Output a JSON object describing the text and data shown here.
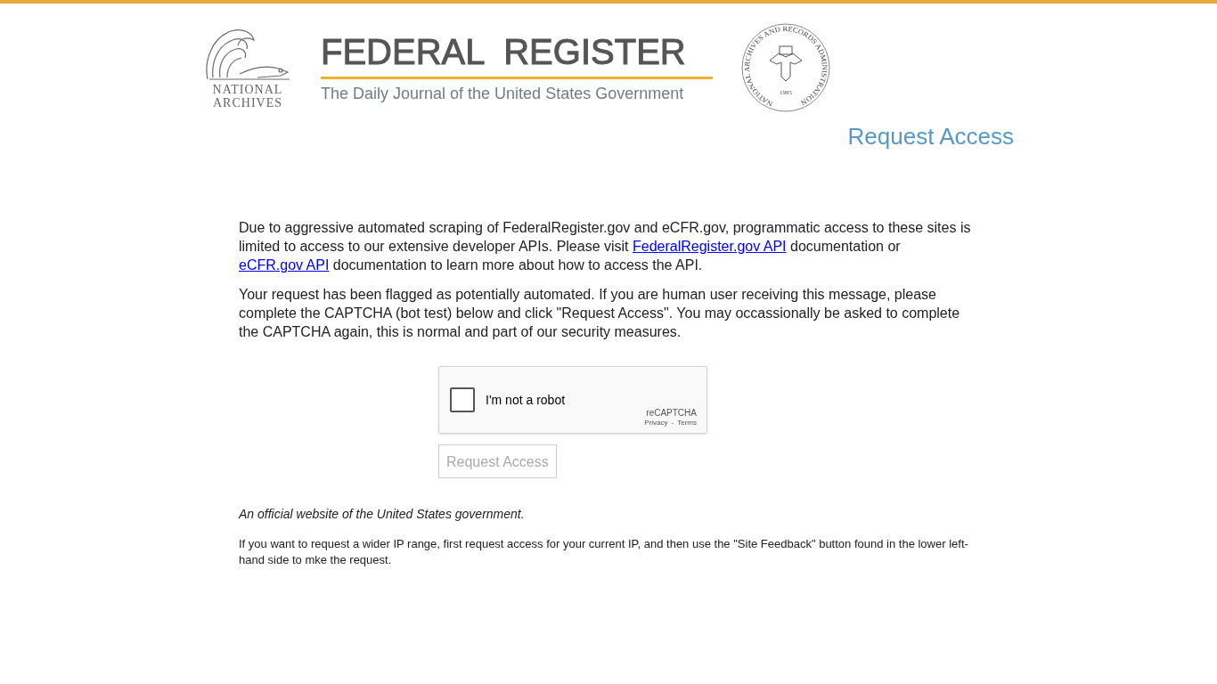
{
  "header": {
    "archives_logo": [
      "NATIONAL",
      "ARCHIVES"
    ],
    "title": "FEDERAL  REGISTER",
    "subtitle": "The Daily Journal of the United States Government",
    "seal": {
      "ring_text": "NATIONAL ARCHIVES AND RECORDS ADMINISTRATION",
      "year": "1985"
    }
  },
  "heading": "Request Access",
  "paragraphs": [
    [
      {
        "kind": "text",
        "text": "Due to aggressive automated scraping of FederalRegister.gov and eCFR.gov, programmatic access to these sites is limited to access to our extensive developer APIs. Please visit "
      },
      {
        "kind": "link",
        "text": "FederalRegister.gov API"
      },
      {
        "kind": "text",
        "text": " documentation or "
      },
      {
        "kind": "link",
        "text": "eCFR.gov API"
      },
      {
        "kind": "text",
        "text": " documentation to learn more about how to access the API."
      }
    ],
    [
      {
        "kind": "text",
        "text": "Your request has been flagged as potentially automated. If you are human user receiving this message, please complete the CAPTCHA (bot test) below and click \"Request Access\". You may occassionally be asked to complete the CAPTCHA again, this is normal and part of our security measures."
      }
    ]
  ],
  "captcha": {
    "label": "I'm not a robot",
    "checked": false,
    "brand": "reCAPTCHA",
    "privacy": "Privacy",
    "separator": "-",
    "terms": "Terms"
  },
  "submit": {
    "label": "Request Access",
    "disabled": true
  },
  "official_notice": "An official website of the United States government.",
  "note": "If you want to request a wider IP range, first request access for your current IP, and then use the \"Site Feedback\" button found in the lower left-hand side to mke the request."
}
